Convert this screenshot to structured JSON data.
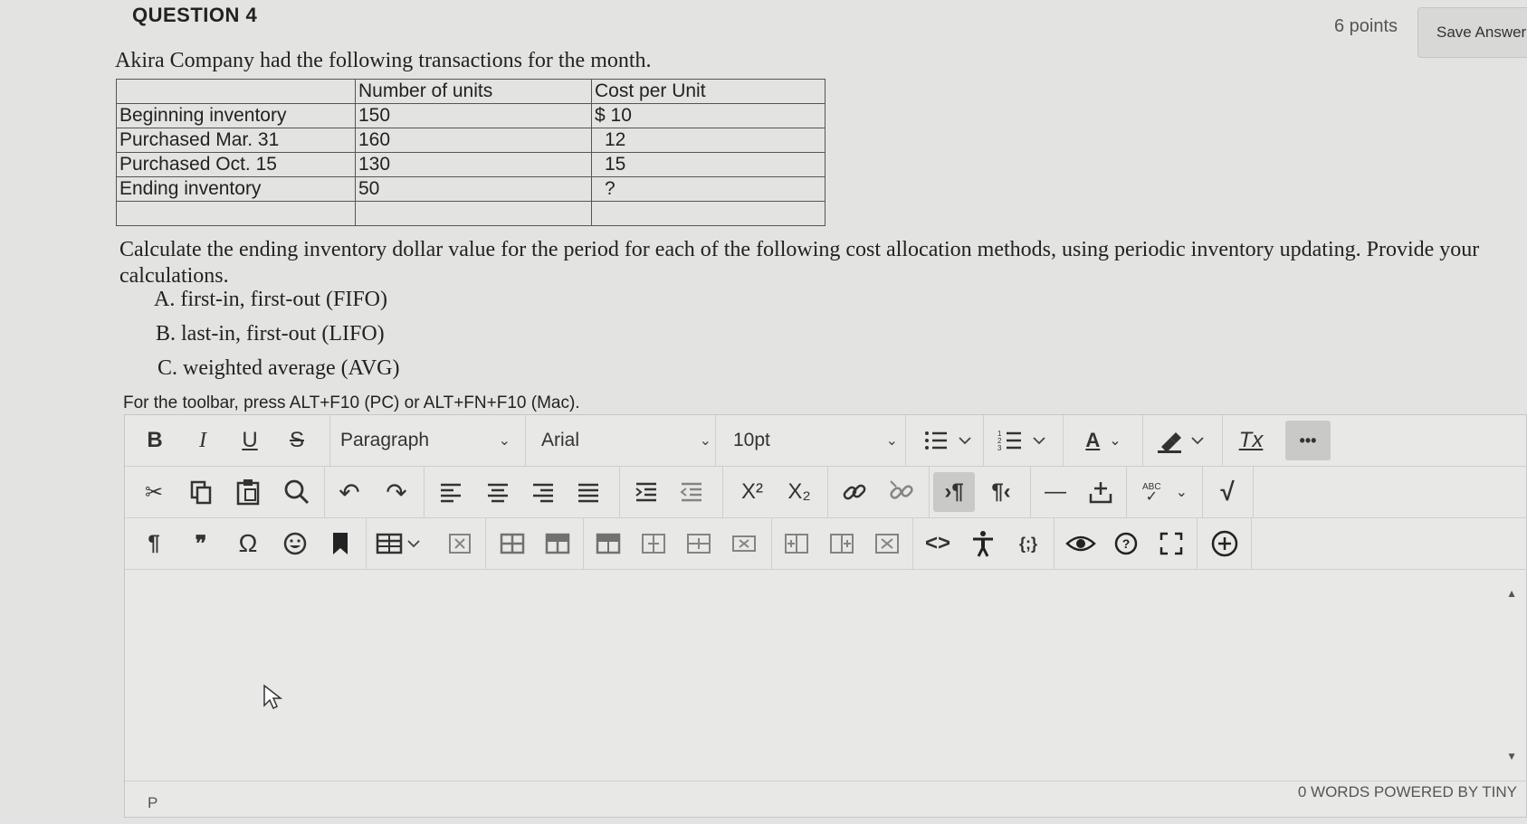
{
  "question": {
    "title": "QUESTION 4",
    "points": "6 points",
    "save_label": "Save Answer",
    "intro": "Akira Company had the following transactions for the month.",
    "table": {
      "headers": [
        "",
        "Number of units",
        "Cost per Unit"
      ],
      "rows": [
        [
          "Beginning inventory",
          "150",
          "$ 10"
        ],
        [
          "Purchased Mar. 31",
          "160",
          "12"
        ],
        [
          "Purchased Oct. 15",
          "130",
          "15"
        ],
        [
          "Ending inventory",
          "50",
          "?"
        ],
        [
          "",
          "",
          ""
        ]
      ]
    },
    "prompt": "Calculate the ending inventory dollar value for the period for each of the following cost allocation methods, using periodic inventory updating. Provide your calculations.",
    "options": [
      {
        "letter": "A.",
        "text": "first-in, first-out (FIFO)"
      },
      {
        "letter": "B.",
        "text": "last-in, first-out (LIFO)"
      },
      {
        "letter": "C.",
        "text": "weighted average (AVG)"
      }
    ],
    "hint": "For the toolbar, press ALT+F10 (PC) or ALT+FN+F10 (Mac)."
  },
  "editor": {
    "block_format": "Paragraph",
    "font_family": "Arial",
    "font_size": "10pt",
    "status_path": "P",
    "word_count": "0 WORDS",
    "powered_by": "POWERED BY TINY",
    "toolbar_glyphs": {
      "bold": "B",
      "italic": "I",
      "underline": "U",
      "strike": "S",
      "more": "•••",
      "superscript": "X²",
      "subscript": "X₂",
      "pilcrow": "¶",
      "quote": "❞",
      "omega": "Ω",
      "code": "<>",
      "codesample": "{;}",
      "clear_format": "Tx",
      "text_color": "A",
      "spellcheck": "ABC",
      "hr": "—"
    }
  }
}
